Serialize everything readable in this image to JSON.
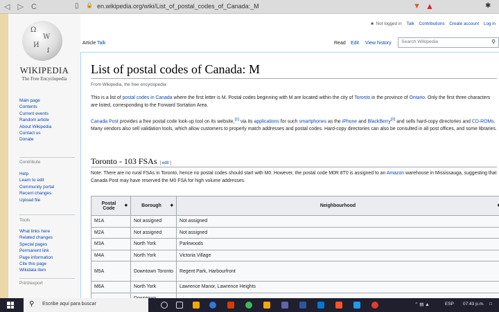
{
  "browser": {
    "address": "en.wikipedia.org/wiki/List_of_postal_codes_of_Canada:_M",
    "nav_glyphs": "◁ ▷ C",
    "ext_shield": "▼",
    "ext_warning": "▲",
    "ext_puzzle": "✱",
    "reader": "▯",
    "lock": "🔒"
  },
  "site": {
    "wordmark": "WIKIPEDIA",
    "tagline": "The Free Encyclopedia",
    "globe_glyphs": [
      "Ω",
      "W",
      "И",
      "វ"
    ]
  },
  "sidebar": {
    "nav": [
      "Main page",
      "Contents",
      "Current events",
      "Random article",
      "About Wikipedia",
      "Contact us",
      "Donate"
    ],
    "contribute_heading": "Contribute",
    "contribute": [
      "Help",
      "Learn to edit",
      "Community portal",
      "Recent changes",
      "Upload file"
    ],
    "tools_heading": "Tools",
    "tools": [
      "What links here",
      "Related changes",
      "Special pages",
      "Permanent link",
      "Page information",
      "Cite this page",
      "Wikidata item"
    ],
    "print_heading": "Print/export"
  },
  "user_links": {
    "not_logged_in": "Not logged in",
    "talk": "Talk",
    "contributions": "Contributions",
    "create_account": "Create account",
    "log_in": "Log in"
  },
  "tabs": {
    "article": "Article",
    "talk": "Talk",
    "read": "Read",
    "edit": "Edit",
    "history": "View history"
  },
  "search": {
    "placeholder": "Search Wikipedia"
  },
  "article": {
    "title": "List of postal codes of Canada: M",
    "from": "From Wikipedia, the free encyclopedia",
    "p1": {
      "a": "This is a list of ",
      "link1": "postal codes in Canada",
      "b": " where the first letter is M. Postal codes beginning with M are located within the city of ",
      "link2": "Toronto",
      "c": " in the province of ",
      "link3": "Ontario",
      "d": ". Only the first three characters are listed, corresponding to the Forward Sortation Area."
    },
    "p2": {
      "link1": "Canada Post",
      "a": " provides a free postal code look-up tool on its website,",
      "ref1": "[1]",
      "b": " via its ",
      "link2": "applications",
      "c": " for such ",
      "link3": "smartphones",
      "d": " as the ",
      "link4": "iPhone",
      "e": " and ",
      "link5": "BlackBerry",
      "ref2": "[2]",
      "f": " and sells hard-copy directories and ",
      "link6": "CD-ROMs",
      "g": ". Many vendors also sell validation tools, which allow customers to properly match addresses and postal codes. Hard-copy directories can also be consulted in all post offices, and some libraries."
    },
    "section": "Toronto - 103 FSAs",
    "edit_link": "edit",
    "note": {
      "a": "Note: There are no rural FSAs in Toronto, hence no postal codes should start with M0. However, the postal code M0R 8T0 is assigned to an ",
      "link": "Amazon",
      "b": " warehouse in Mississauga, suggesting that Canada Post may have reserved the M0 FSA for high volume addresses."
    }
  },
  "table": {
    "headers": [
      "Postal Code",
      "Borough",
      "Neighbourhood"
    ],
    "sort_glyph": "◆",
    "rows": [
      [
        "M1A",
        "Not assigned",
        "Not assigned"
      ],
      [
        "M2A",
        "Not assigned",
        "Not assigned"
      ],
      [
        "M3A",
        "North York",
        "Parkwoods"
      ],
      [
        "M4A",
        "North York",
        "Victoria Village"
      ],
      [
        "M5A",
        "Downtown Toronto",
        "Regent Park, Harbourfront"
      ],
      [
        "M6A",
        "North York",
        "Lawrence Manor, Lawrence Heights"
      ],
      [
        "",
        "Downtown",
        ""
      ]
    ]
  },
  "taskbar": {
    "search_placeholder": "Escribe aquí para buscar",
    "tray_lang": "ESP",
    "tray_time": "07:43 p.m.",
    "colors": {
      "edge": "#2f7ad6",
      "chrome": "#3cba54",
      "brave": "#fb542b",
      "word": "#2b579a",
      "accent": "#f2a900"
    }
  },
  "colors": {
    "link": "#0645ad",
    "table_head": "#eaecf0",
    "table_cell": "#f8f9fa",
    "frame": "#ead8a6"
  }
}
